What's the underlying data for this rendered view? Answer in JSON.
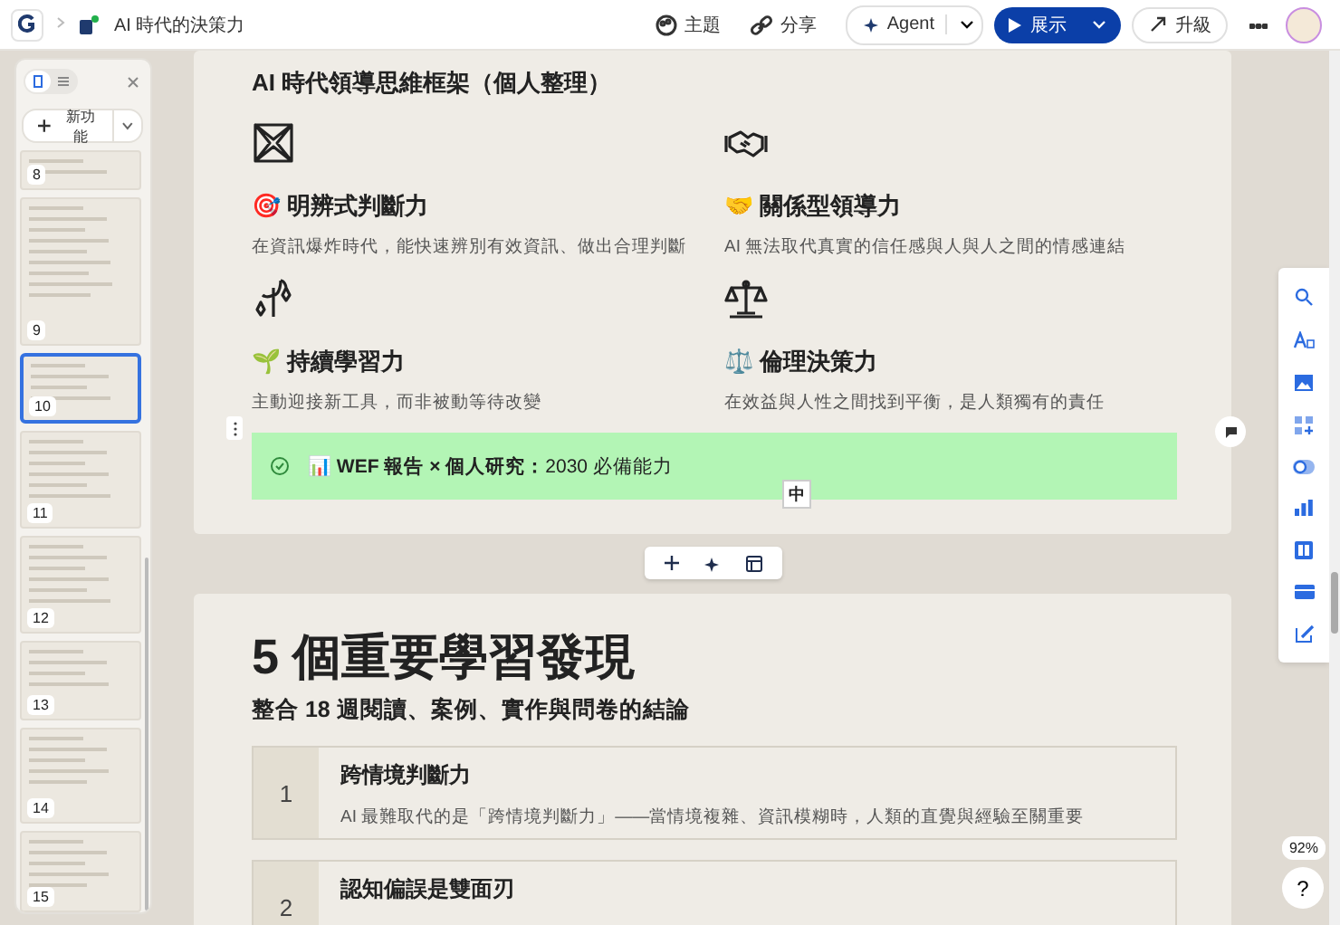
{
  "topbar": {
    "document_title": "AI 時代的決策力",
    "actions": [
      {
        "kind": "theme",
        "label": "主題"
      },
      {
        "kind": "share",
        "label": "分享"
      }
    ],
    "agent_button": {
      "label": "Agent"
    },
    "present_button": {
      "label": "展示"
    },
    "upgrade_button": {
      "label": "升級"
    }
  },
  "sidebar": {
    "view_modes": [
      {
        "kind": "thumbnails",
        "selected": true
      },
      {
        "kind": "list",
        "selected": false
      }
    ],
    "new_button": {
      "label": "新功能"
    },
    "slides": [
      {
        "number": "8",
        "selected": false
      },
      {
        "number": "9",
        "selected": false
      },
      {
        "number": "10",
        "selected": true
      },
      {
        "number": "11",
        "selected": false
      },
      {
        "number": "12",
        "selected": false
      },
      {
        "number": "13",
        "selected": false
      },
      {
        "number": "14",
        "selected": false
      },
      {
        "number": "15",
        "selected": false
      }
    ]
  },
  "slide_1": {
    "subtitle": "AI 時代領導思維框架（個人整理）",
    "pillars": [
      {
        "title": "🎯 明辨式判斷力",
        "description": "在資訊爆炸時代，能快速辨別有效資訊、做出合理判斷"
      },
      {
        "title": "🤝 關係型領導力",
        "description": "AI 無法取代真實的信任感與人與人之間的情感連結"
      },
      {
        "title": "🌱 持續學習力",
        "description": "主動迎接新工具，而非被動等待改變"
      },
      {
        "title": "⚖️ 倫理決策力",
        "description": "在效益與人性之間找到平衡，是人類獨有的責任"
      }
    ],
    "callout": {
      "text": "📊 **WEF 報告 × 個人研究：**2030 必備能力"
    },
    "input_method_badge": "中"
  },
  "slide_2": {
    "title": "5 個重要學習發現",
    "subtitle": "整合 18 週閱讀、案例、實作與問卷的結論",
    "findings": [
      {
        "number": "1",
        "title": "跨情境判斷力",
        "description": "AI 最難取代的是「跨情境判斷力」——當情境複雜、資訊模糊時，人類的直覺與經驗至關重要"
      },
      {
        "number": "2",
        "title": "認知偏誤是雙面刃"
      }
    ]
  },
  "zoom_level": "92%",
  "help_button": "?"
}
